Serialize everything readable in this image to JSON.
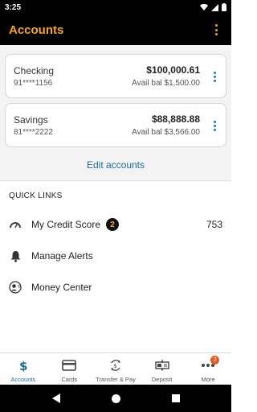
{
  "status": {
    "time": "3:25"
  },
  "header": {
    "title": "Accounts"
  },
  "accounts": [
    {
      "name": "Checking",
      "number": "91****1156",
      "balance": "$100,000.61",
      "available": "Avail bal $1,500.00"
    },
    {
      "name": "Savings",
      "number": "81****2222",
      "balance": "$88,888.88",
      "available": "Avail bal $3,566.00"
    }
  ],
  "edit_accounts_label": "Edit accounts",
  "quick_links": {
    "header": "QUICK LINKS",
    "items": [
      {
        "label": "My Credit Score",
        "badge": "2",
        "value": "753",
        "icon": "gauge-icon"
      },
      {
        "label": "Manage Alerts",
        "icon": "bell-icon"
      },
      {
        "label": "Money Center",
        "icon": "money-center-icon"
      }
    ]
  },
  "bottom_nav": [
    {
      "label": "Accounts",
      "icon": "dollar-icon",
      "active": true
    },
    {
      "label": "Cards",
      "icon": "card-icon"
    },
    {
      "label": "Transfer & Pay",
      "icon": "transfer-icon"
    },
    {
      "label": "Deposit",
      "icon": "deposit-icon"
    },
    {
      "label": "More",
      "icon": "more-icon",
      "badge": "2"
    }
  ],
  "colors": {
    "accent": "#f5a623",
    "link": "#1a6f97",
    "badge_orange": "#e65c1c"
  }
}
